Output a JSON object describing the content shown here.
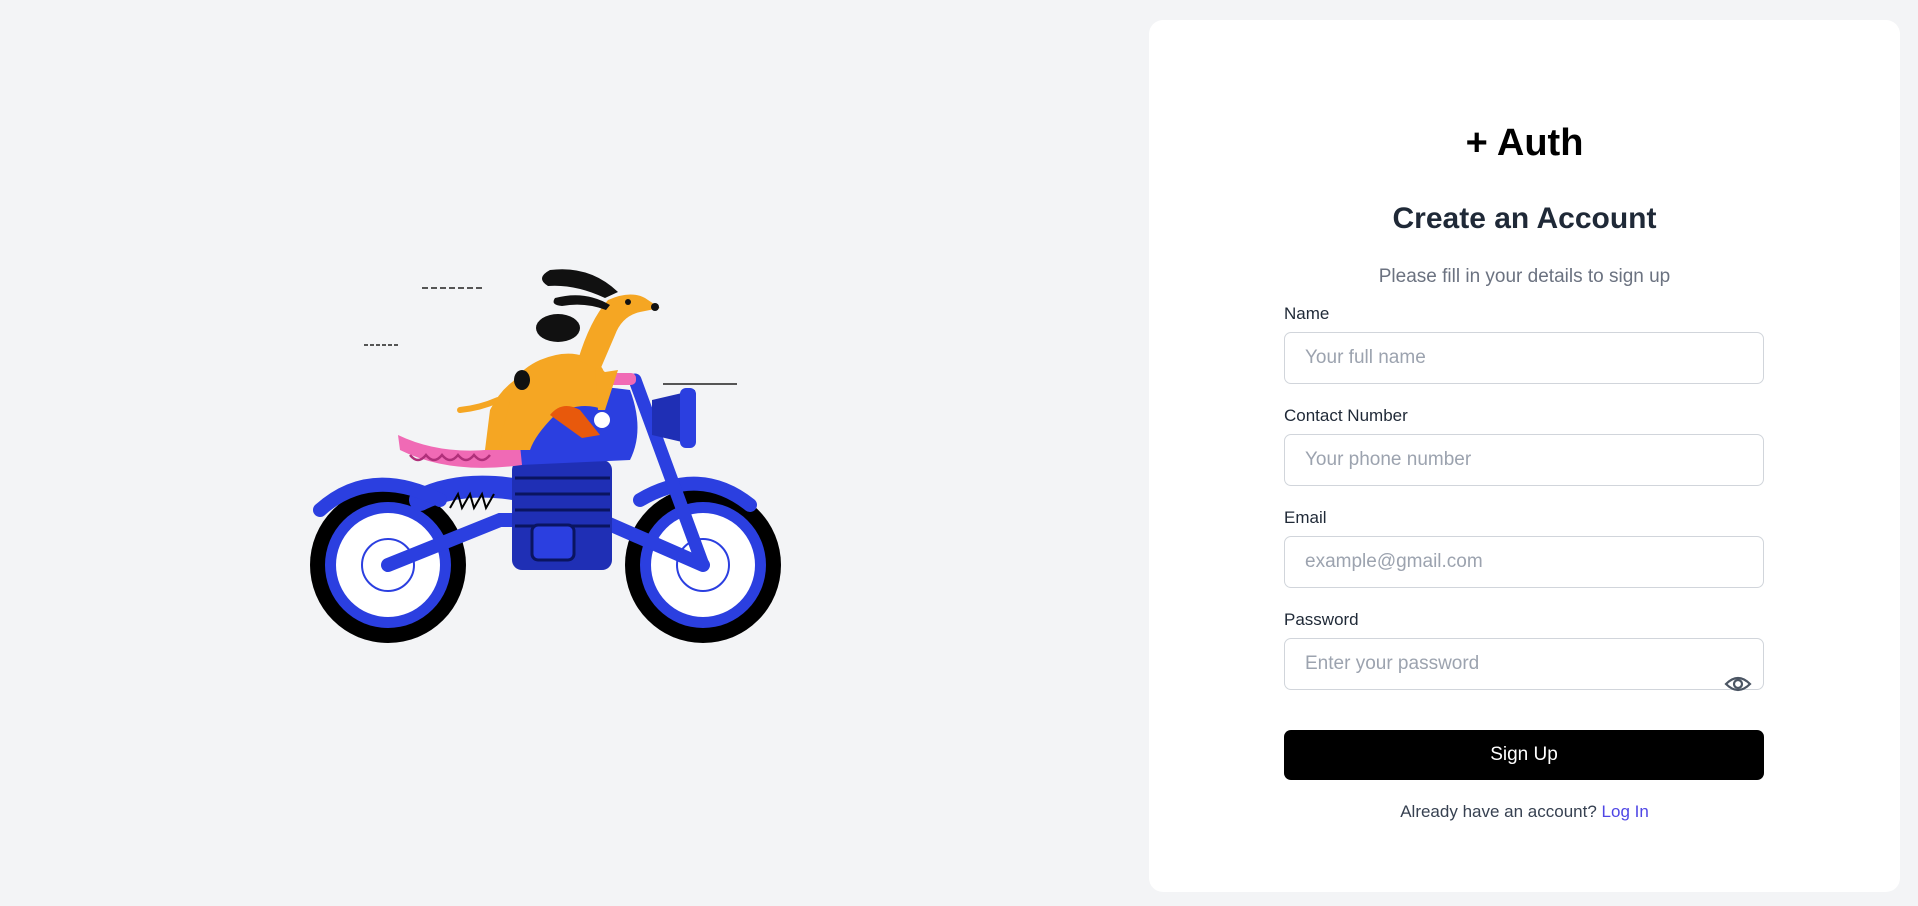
{
  "brand": {
    "logo_text": "+ Auth"
  },
  "form": {
    "title": "Create an Account",
    "subtitle": "Please fill in your details to sign up",
    "fields": [
      {
        "label": "Name",
        "placeholder": "Your full name",
        "value": ""
      },
      {
        "label": "Contact Number",
        "placeholder": "Your phone number",
        "value": ""
      },
      {
        "label": "Email",
        "placeholder": "example@gmail.com",
        "value": ""
      },
      {
        "label": "Password",
        "placeholder": "Enter your password",
        "value": "",
        "toggle_icon": "eye-icon"
      }
    ],
    "submit_label": "Sign Up",
    "footer_prompt": "Already have an account?",
    "footer_link": "Log In"
  },
  "colors": {
    "background": "#f3f4f6",
    "card": "#ffffff",
    "primary_button": "#000000",
    "link": "#4f46e5"
  },
  "illustration": {
    "icon": "dog-riding-motorcycle-illustration"
  }
}
